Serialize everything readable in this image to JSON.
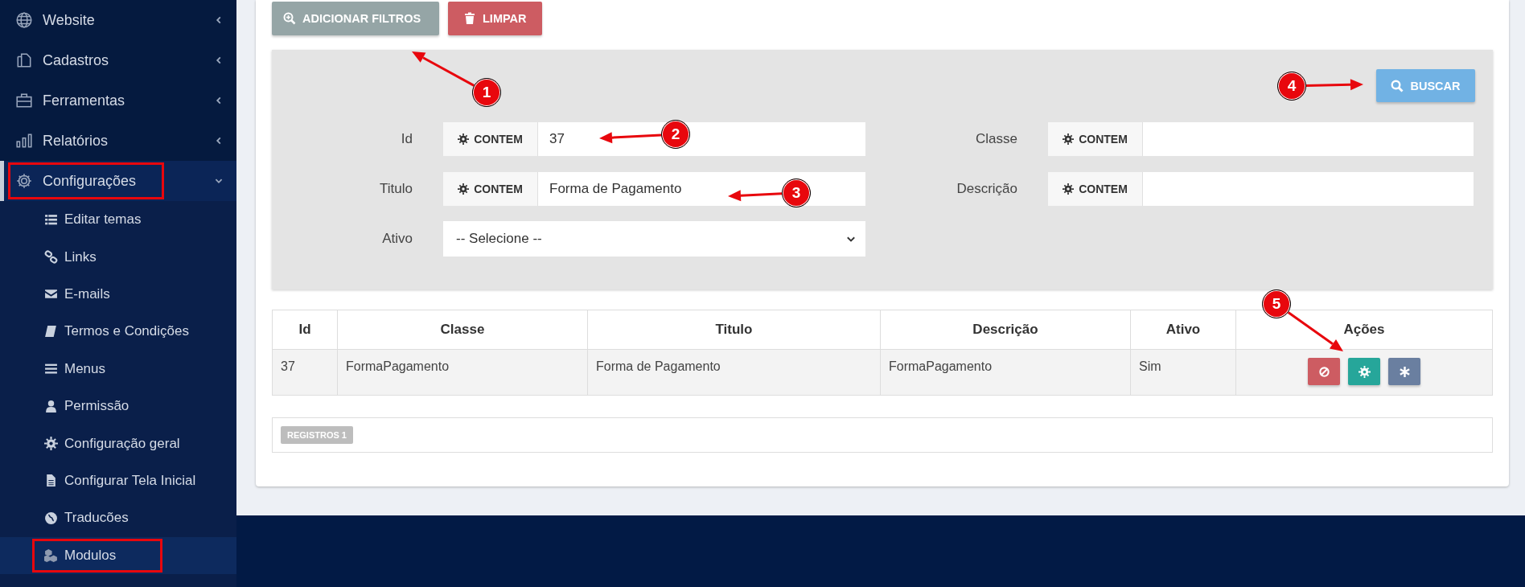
{
  "sidebar": {
    "items": [
      {
        "label": "Website",
        "expanded": false,
        "outlined": false
      },
      {
        "label": "Cadastros",
        "expanded": false,
        "outlined": false
      },
      {
        "label": "Ferramentas",
        "expanded": false,
        "outlined": false
      },
      {
        "label": "Relatórios",
        "expanded": false,
        "outlined": false
      },
      {
        "label": "Configurações",
        "expanded": true,
        "outlined": true,
        "children": [
          {
            "label": "Editar temas",
            "selected": false,
            "outlined": false
          },
          {
            "label": "Links",
            "selected": false,
            "outlined": false
          },
          {
            "label": "E-mails",
            "selected": false,
            "outlined": false
          },
          {
            "label": "Termos e Condições",
            "selected": false,
            "outlined": false
          },
          {
            "label": "Menus",
            "selected": false,
            "outlined": false
          },
          {
            "label": "Permissão",
            "selected": false,
            "outlined": false
          },
          {
            "label": "Configuração geral",
            "selected": false,
            "outlined": false
          },
          {
            "label": "Configurar Tela Inicial",
            "selected": false,
            "outlined": false
          },
          {
            "label": "Traducões",
            "selected": false,
            "outlined": false
          },
          {
            "label": "Modulos",
            "selected": true,
            "outlined": true
          }
        ]
      }
    ]
  },
  "toolbar": {
    "buttons": [
      {
        "label": "ADICIONAR FILTROS",
        "kind": "add"
      },
      {
        "label": "LIMPAR",
        "kind": "clear"
      }
    ]
  },
  "filters": {
    "search_button": "BUSCAR",
    "fields": [
      {
        "label": "Id",
        "kind": "text",
        "operator": "CONTEM",
        "value": "37"
      },
      {
        "label": "Classe",
        "kind": "text",
        "operator": "CONTEM"
      },
      {
        "label": "Titulo",
        "kind": "text",
        "operator": "CONTEM",
        "value": "Forma de Pagamento"
      },
      {
        "label": "Descrição",
        "kind": "text",
        "operator": "CONTEM"
      },
      {
        "label": "Ativo",
        "kind": "select",
        "value": "-- Selecione --"
      }
    ]
  },
  "table": {
    "columns": [
      "Id",
      "Classe",
      "Titulo",
      "Descrição",
      "Ativo",
      "Ações"
    ],
    "rows": [
      {
        "cells": [
          "37",
          "FormaPagamento",
          "Forma de Pagamento",
          "FormaPagamento",
          "Sim"
        ],
        "actions": [
          {
            "kind": "disable"
          },
          {
            "kind": "settings"
          },
          {
            "kind": "asterisk"
          }
        ]
      }
    ]
  },
  "records_badge": "REGISTROS 1",
  "annotations": [
    {
      "number": "1"
    },
    {
      "number": "2"
    },
    {
      "number": "3"
    },
    {
      "number": "4"
    },
    {
      "number": "5"
    }
  ]
}
